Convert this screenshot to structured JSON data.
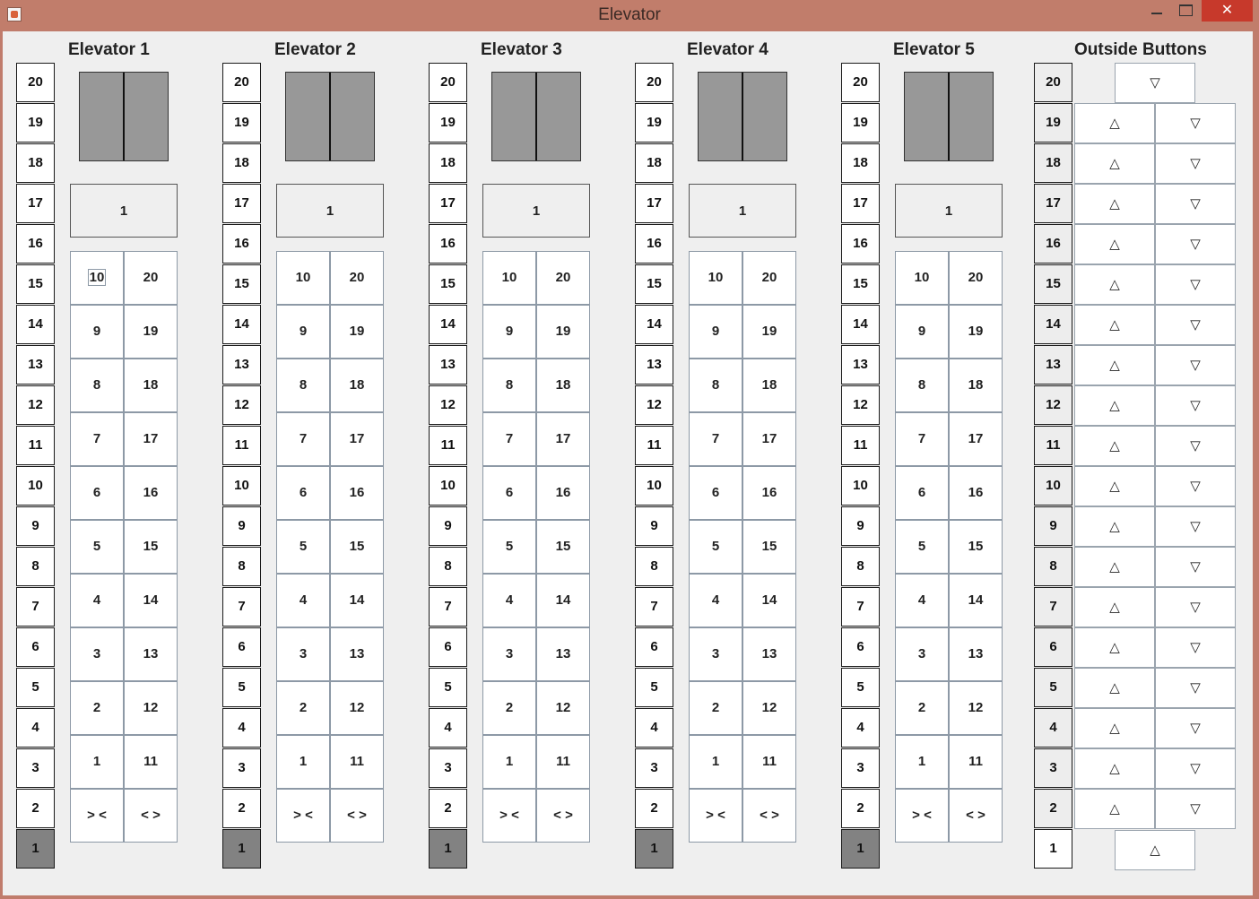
{
  "window": {
    "title": "Elevator",
    "close_glyph": "✕"
  },
  "elevators": [
    {
      "title": "Elevator 1",
      "display": "1",
      "active_floor": 1
    },
    {
      "title": "Elevator 2",
      "display": "1",
      "active_floor": 1
    },
    {
      "title": "Elevator 3",
      "display": "1",
      "active_floor": 1
    },
    {
      "title": "Elevator 4",
      "display": "1",
      "active_floor": 1
    },
    {
      "title": "Elevator 5",
      "display": "1",
      "active_floor": 1
    }
  ],
  "floors": [
    "20",
    "19",
    "18",
    "17",
    "16",
    "15",
    "14",
    "13",
    "12",
    "11",
    "10",
    "9",
    "8",
    "7",
    "6",
    "5",
    "4",
    "3",
    "2",
    "1"
  ],
  "panel_rows": [
    [
      "10",
      "20"
    ],
    [
      "9",
      "19"
    ],
    [
      "8",
      "18"
    ],
    [
      "7",
      "17"
    ],
    [
      "6",
      "16"
    ],
    [
      "5",
      "15"
    ],
    [
      "4",
      "14"
    ],
    [
      "3",
      "13"
    ],
    [
      "2",
      "12"
    ],
    [
      "1",
      "11"
    ],
    [
      "> <",
      "< >"
    ]
  ],
  "outside": {
    "title": "Outside Buttons",
    "up_symbol": "△",
    "down_symbol": "▽"
  }
}
